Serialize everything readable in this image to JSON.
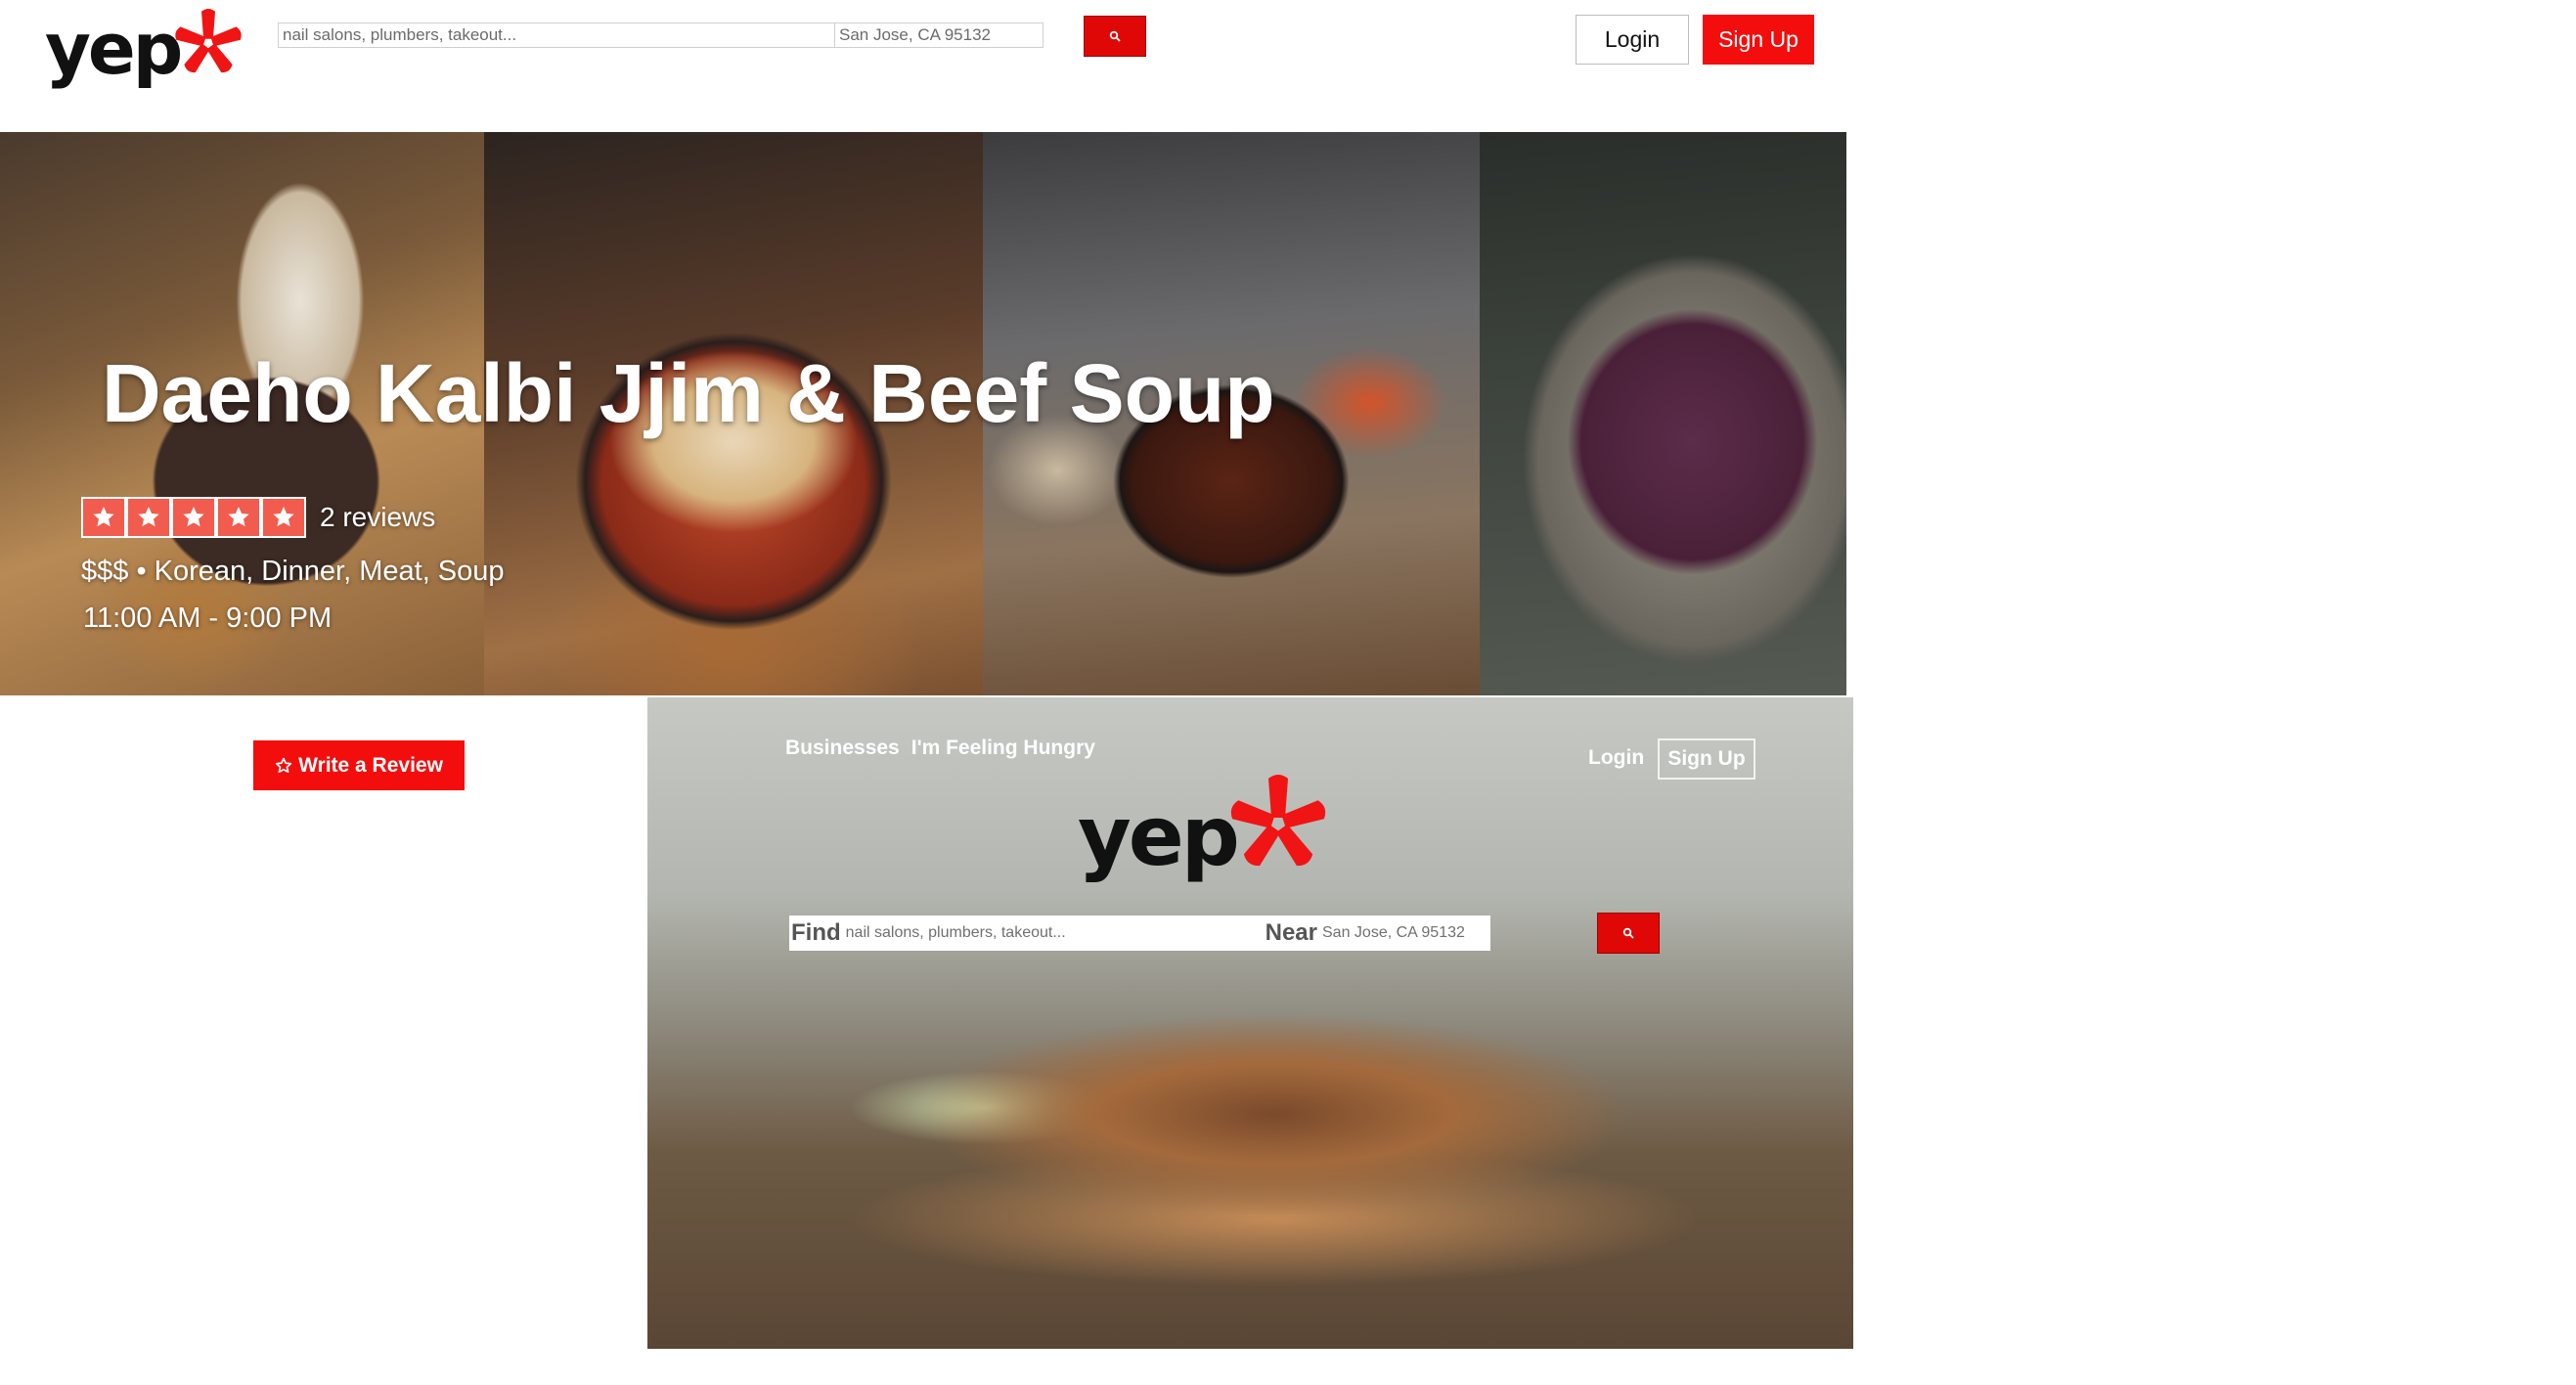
{
  "header": {
    "logo_text": "yep",
    "search_placeholder": "nail salons, plumbers, takeout...",
    "location_placeholder": "San Jose, CA 95132",
    "login_label": "Login",
    "signup_label": "Sign Up"
  },
  "business": {
    "name": "Daeho Kalbi Jjim & Beef Soup",
    "rating": 5,
    "rating_max": 5,
    "reviews_label": "2 reviews",
    "categories_line": "$$$ • Korean, Dinner, Meat, Soup",
    "hours": "11:00 AM - 9:00 PM"
  },
  "actions": {
    "write_review_label": "Write a Review"
  },
  "preview": {
    "nav": [
      "Businesses",
      "I'm Feeling Hungry"
    ],
    "login_label": "Login",
    "signup_label": "Sign Up",
    "logo_text": "yep",
    "find_label": "Find",
    "find_placeholder": "nail salons, plumbers, takeout...",
    "near_label": "Near",
    "near_placeholder": "San Jose, CA 95132"
  },
  "colors": {
    "brand_red": "#f40d0d",
    "star_red": "#f15c4f"
  },
  "icons": [
    "burst-logo-icon",
    "search-icon",
    "star-icon"
  ]
}
